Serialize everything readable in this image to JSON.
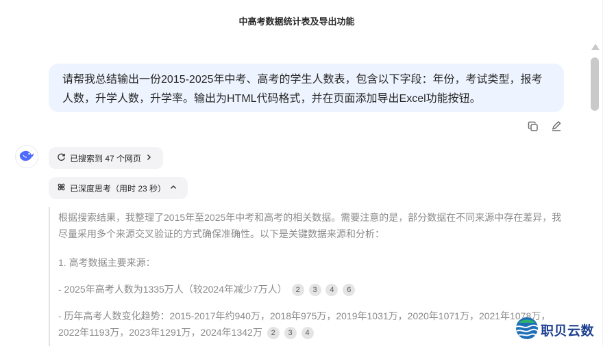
{
  "header": {
    "title": "中高考数据统计表及导出功能"
  },
  "user_message": {
    "text": "请帮我总结输出一份2015-2025年中考、高考的学生人数表，包含以下字段：年份，考试类型，报考人数，升学人数，升学率。输出为HTML代码格式，并在页面添加导出Excel功能按钮。"
  },
  "message_actions": {
    "copy_icon": "copy-icon",
    "edit_icon": "edit-icon"
  },
  "assistant": {
    "avatar_icon": "whale-logo-icon",
    "search_pill": {
      "label": "已搜索到 47 个网页",
      "icon": "search-refresh-icon"
    },
    "think_pill": {
      "label": "已深度思考（用时 23 秒）",
      "icon": "atom-icon"
    },
    "thinking": {
      "para1": "根据搜索结果，我整理了2015年至2025年中考和高考的相关数据。需要注意的是，部分数据在不同来源中存在差异，我尽量采用多个来源交叉验证的方式确保准确性。以下是关键数据来源和分析：",
      "heading1": "1. 高考数据主要来源：",
      "line1": "- 2025年高考人数为1335万人（较2024年减少7万人）",
      "line1_cites": [
        "2",
        "3",
        "4",
        "6"
      ],
      "line2": "- 历年高考人数变化趋势：2015-2017年约940万，2018年975万，2019年1031万，2020年1071万，2021年1078万，2022年1193万，2023年1291万，2024年1342万",
      "line2_cites": [
        "2",
        "3",
        "4"
      ]
    }
  },
  "watermark": {
    "text": "职贝云数"
  },
  "colors": {
    "bubble": "#eef4ff",
    "pill": "#f3f3f5",
    "brand": "#1d3f8f",
    "muted": "#8b8b8b"
  }
}
